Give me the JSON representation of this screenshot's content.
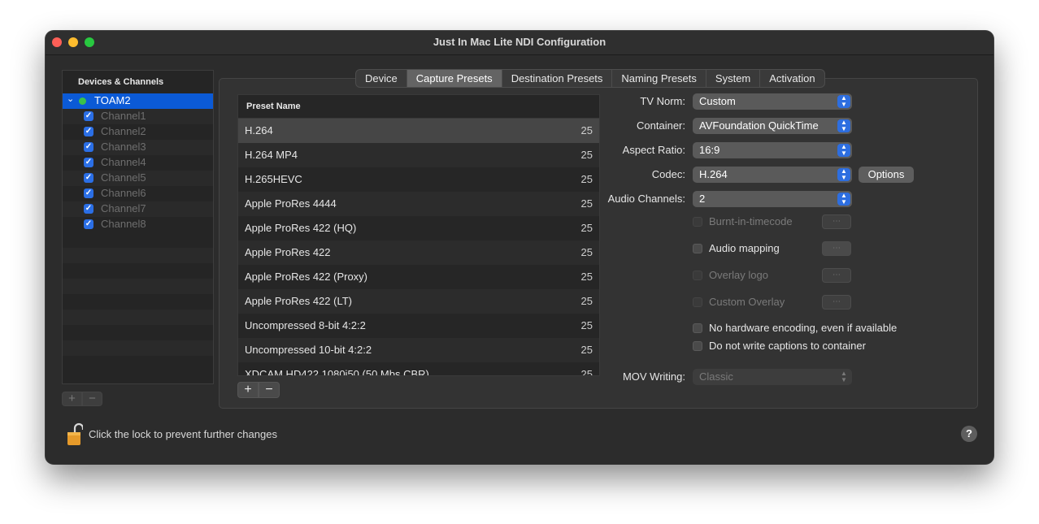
{
  "window": {
    "title": "Just In Mac Lite NDI Configuration"
  },
  "sidebar": {
    "header": "Devices & Channels",
    "device": {
      "name": "TOAM2"
    },
    "channels": [
      {
        "label": "Channel1",
        "checked": true
      },
      {
        "label": "Channel2",
        "checked": true
      },
      {
        "label": "Channel3",
        "checked": true
      },
      {
        "label": "Channel4",
        "checked": true
      },
      {
        "label": "Channel5",
        "checked": true
      },
      {
        "label": "Channel6",
        "checked": true
      },
      {
        "label": "Channel7",
        "checked": true
      },
      {
        "label": "Channel8",
        "checked": true
      }
    ],
    "add_label": "+",
    "remove_label": "−"
  },
  "tabs": [
    {
      "label": "Device"
    },
    {
      "label": "Capture Presets",
      "active": true
    },
    {
      "label": "Destination Presets"
    },
    {
      "label": "Naming Presets"
    },
    {
      "label": "System"
    },
    {
      "label": "Activation"
    }
  ],
  "presets": {
    "header": "Preset Name",
    "rows": [
      {
        "name": "H.264",
        "fps": "25",
        "selected": true
      },
      {
        "name": "H.264 MP4",
        "fps": "25"
      },
      {
        "name": "H.265HEVC",
        "fps": "25"
      },
      {
        "name": "Apple ProRes 4444",
        "fps": "25"
      },
      {
        "name": "Apple ProRes 422 (HQ)",
        "fps": "25"
      },
      {
        "name": "Apple ProRes 422",
        "fps": "25"
      },
      {
        "name": "Apple ProRes 422 (Proxy)",
        "fps": "25"
      },
      {
        "name": "Apple ProRes 422 (LT)",
        "fps": "25"
      },
      {
        "name": "Uncompressed 8-bit 4:2:2",
        "fps": "25"
      },
      {
        "name": "Uncompressed 10-bit 4:2:2",
        "fps": "25"
      },
      {
        "name": "XDCAM HD422 1080i50 (50 Mbs CBR)",
        "fps": "25"
      }
    ],
    "add_label": "+",
    "remove_label": "−"
  },
  "settings": {
    "tv_norm": {
      "label": "TV Norm:",
      "value": "Custom"
    },
    "container": {
      "label": "Container:",
      "value": "AVFoundation QuickTime"
    },
    "aspect_ratio": {
      "label": "Aspect Ratio:",
      "value": "16:9"
    },
    "codec": {
      "label": "Codec:",
      "value": "H.264",
      "options_label": "Options"
    },
    "audio_channels": {
      "label": "Audio Channels:",
      "value": "2"
    },
    "burnt_in_timecode": {
      "label": "Burnt-in-timecode",
      "checked": false,
      "enabled": false
    },
    "audio_mapping": {
      "label": "Audio mapping",
      "checked": false,
      "enabled": true
    },
    "overlay_logo": {
      "label": "Overlay logo",
      "checked": false,
      "enabled": false
    },
    "custom_overlay": {
      "label": "Custom Overlay",
      "checked": false,
      "enabled": false
    },
    "no_hw_encoding": {
      "label": "No hardware encoding, even if available",
      "checked": false
    },
    "no_captions": {
      "label": "Do not write captions to container",
      "checked": false
    },
    "mov_writing": {
      "label": "MOV Writing:",
      "value": "Classic",
      "enabled": false
    }
  },
  "footer": {
    "lock_text": "Click the lock to prevent further changes",
    "help_label": "?"
  },
  "colors": {
    "accent": "#0b5ad6",
    "status_green": "#3bc24a"
  }
}
